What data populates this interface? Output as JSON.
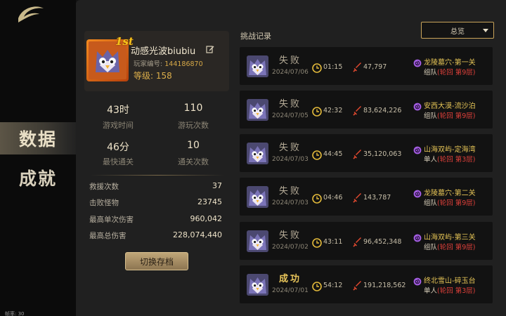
{
  "nav": {
    "items": [
      {
        "label": "数据",
        "active": true
      },
      {
        "label": "成就",
        "active": false
      }
    ],
    "fps_text": "帧率: 30"
  },
  "profile": {
    "name": "动感光波biubiu",
    "rank_badge": "1st",
    "player_id_label": "玩家编号:",
    "player_id": "144186870",
    "level_label": "等级:",
    "level": "158"
  },
  "stats": {
    "grid": [
      {
        "value": "43时",
        "label": "游戏时间"
      },
      {
        "value": "110",
        "label": "游玩次数"
      },
      {
        "value": "46分",
        "label": "最快通关"
      },
      {
        "value": "10",
        "label": "通关次数"
      }
    ],
    "rows": [
      {
        "label": "救援次数",
        "value": "37"
      },
      {
        "label": "击败怪物",
        "value": "23745"
      },
      {
        "label": "最高单次伤害",
        "value": "960,042"
      },
      {
        "label": "最高总伤害",
        "value": "228,074,440"
      }
    ],
    "switch_button": "切换存档"
  },
  "records": {
    "title": "挑战记录",
    "filter": "总览",
    "items": [
      {
        "result": "失败",
        "win": false,
        "date": "2024/07/06",
        "time": "01:15",
        "damage": "47,797",
        "stage": "龙陵墓穴-第一关",
        "mode": "组队",
        "cycle": "(轮回  第9层)"
      },
      {
        "result": "失败",
        "win": false,
        "date": "2024/07/05",
        "time": "42:32",
        "damage": "83,624,226",
        "stage": "安西大漠-流沙泊",
        "mode": "组队",
        "cycle": "(轮回  第9层)"
      },
      {
        "result": "失败",
        "win": false,
        "date": "2024/07/03",
        "time": "44:45",
        "damage": "35,120,063",
        "stage": "山海双屿-定海湾",
        "mode": "单人",
        "cycle": "(轮回  第3层)"
      },
      {
        "result": "失败",
        "win": false,
        "date": "2024/07/03",
        "time": "04:46",
        "damage": "143,787",
        "stage": "龙陵墓穴-第二关",
        "mode": "组队",
        "cycle": "(轮回  第9层)"
      },
      {
        "result": "失败",
        "win": false,
        "date": "2024/07/02",
        "time": "43:11",
        "damage": "96,452,348",
        "stage": "山海双屿-第三关",
        "mode": "组队",
        "cycle": "(轮回  第9层)"
      },
      {
        "result": "成功",
        "win": true,
        "date": "2024/07/01",
        "time": "54:12",
        "damage": "191,218,562",
        "stage": "终北雪山-碎玉台",
        "mode": "单人",
        "cycle": "(轮回  第3层)"
      }
    ]
  },
  "colors": {
    "accent_gold": "#dcae4a",
    "fail_text": "#b6ac98",
    "win_text": "#e7c45a",
    "cycle_red": "#e0403a",
    "spiral_purple": "#a25de0"
  },
  "icons": {
    "logo": "crescent-logo-icon",
    "edit": "edit-icon",
    "clock": "clock-icon",
    "sword": "sword-icon",
    "spiral": "spiral-icon",
    "dropdown": "chevron-down-icon"
  }
}
